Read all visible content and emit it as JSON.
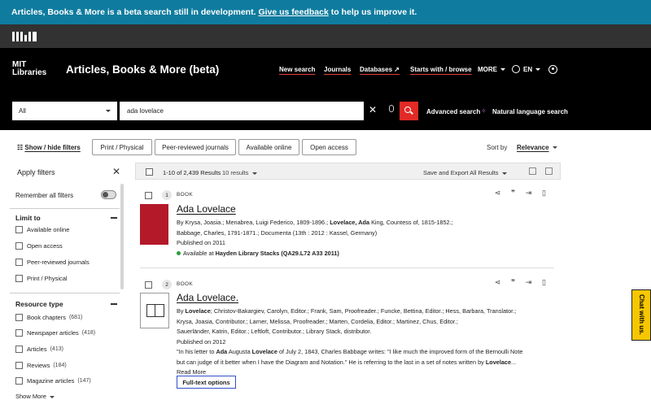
{
  "banner": {
    "text": "Articles, Books & More is a beta search still in development.",
    "link": "Give us feedback",
    "suffix": "to help us improve it."
  },
  "header": {
    "logo_line1": "MIT",
    "logo_line2": "Libraries",
    "title": "Articles, Books & More (beta)",
    "nav": [
      "New search",
      "Journals",
      "Databases ↗",
      "Starts with / browse",
      "MORE"
    ],
    "lang": "EN"
  },
  "search": {
    "scope": "All",
    "query": "ada lovelace",
    "advanced": "Advanced search",
    "natural": "Natural language search"
  },
  "filters_bar": {
    "toggle": "Show / hide filters",
    "chips": [
      "Print / Physical",
      "Peer-reviewed journals",
      "Available online",
      "Open access"
    ],
    "sort_label": "Sort by",
    "sort_value": "Relevance"
  },
  "sidebar": {
    "title": "Apply filters",
    "remember": "Remember all filters",
    "limit_title": "Limit to",
    "limit_items": [
      "Available online",
      "Open access",
      "Peer-reviewed journals",
      "Print / Physical"
    ],
    "resource_title": "Resource type",
    "resource_items": [
      {
        "label": "Book chapters",
        "count": "(681)"
      },
      {
        "label": "Newspaper articles",
        "count": "(418)"
      },
      {
        "label": "Articles",
        "count": "(413)"
      },
      {
        "label": "Reviews",
        "count": "(184)"
      },
      {
        "label": "Magazine articles",
        "count": "(147)"
      }
    ],
    "show_more": "Show More"
  },
  "results_header": {
    "count": "1-10 of 2,439 Results",
    "per_page": "10 results",
    "export": "Save and Export All Results"
  },
  "results": [
    {
      "num": "1",
      "type": "BOOK",
      "title": "Ada Lovelace",
      "by": "By Krysa, Joasia.; Menabrea, Luigi Federico, 1809-1896.;",
      "by_hl": "Lovelace, Ada",
      "by_rest": "King, Countess of, 1815-1852.;",
      "line2": "Babbage, Charles, 1791-1871.; Documenta (13th : 2012 : Kassel, Germany)",
      "published": "Published on 2011",
      "avail_prefix": "Available at",
      "avail_loc": "Hayden Library Stacks (QA29.L72 A33 2011)"
    },
    {
      "num": "2",
      "type": "BOOK",
      "title": "Ada Lovelace.",
      "by_prefix": "By",
      "by_hl": "Lovelace",
      "line1": "; Christov-Bakargiev, Carolyn, Editor.; Frank, Sam, Proofreader.; Funcke, Bettina, Editor.; Hess, Barbara, Translator.;",
      "line2": "Krysa, Joasia, Contributor.; Larner, Melissa, Proofreader.; Marten, Cordelia, Editor.; Martinez, Chus, Editor.;",
      "line3": "Sauerländer, Katrin, Editor.; Leftloft, Contributor.; Library Stack, distributor.",
      "published": "Published on 2012",
      "snippet1a": "\"In his letter to",
      "snippet1hl": "Ada",
      "snippet1b": "Augusta",
      "snippet1hl2": "Lovelace",
      "snippet1c": "of July 2, 1843, Charles Babbage writes: \"I like much the improved form of the Bernoulli Note",
      "snippet2": "but can judge of it better when I have the Diagram and Notation.\" He is referring to the last in a set of notes written by",
      "snippet2hl": "Lovelace",
      "snippet2end": "...",
      "read_more": "Read More",
      "fulltext": "Full-text options"
    }
  ],
  "chat": "Chat with us."
}
